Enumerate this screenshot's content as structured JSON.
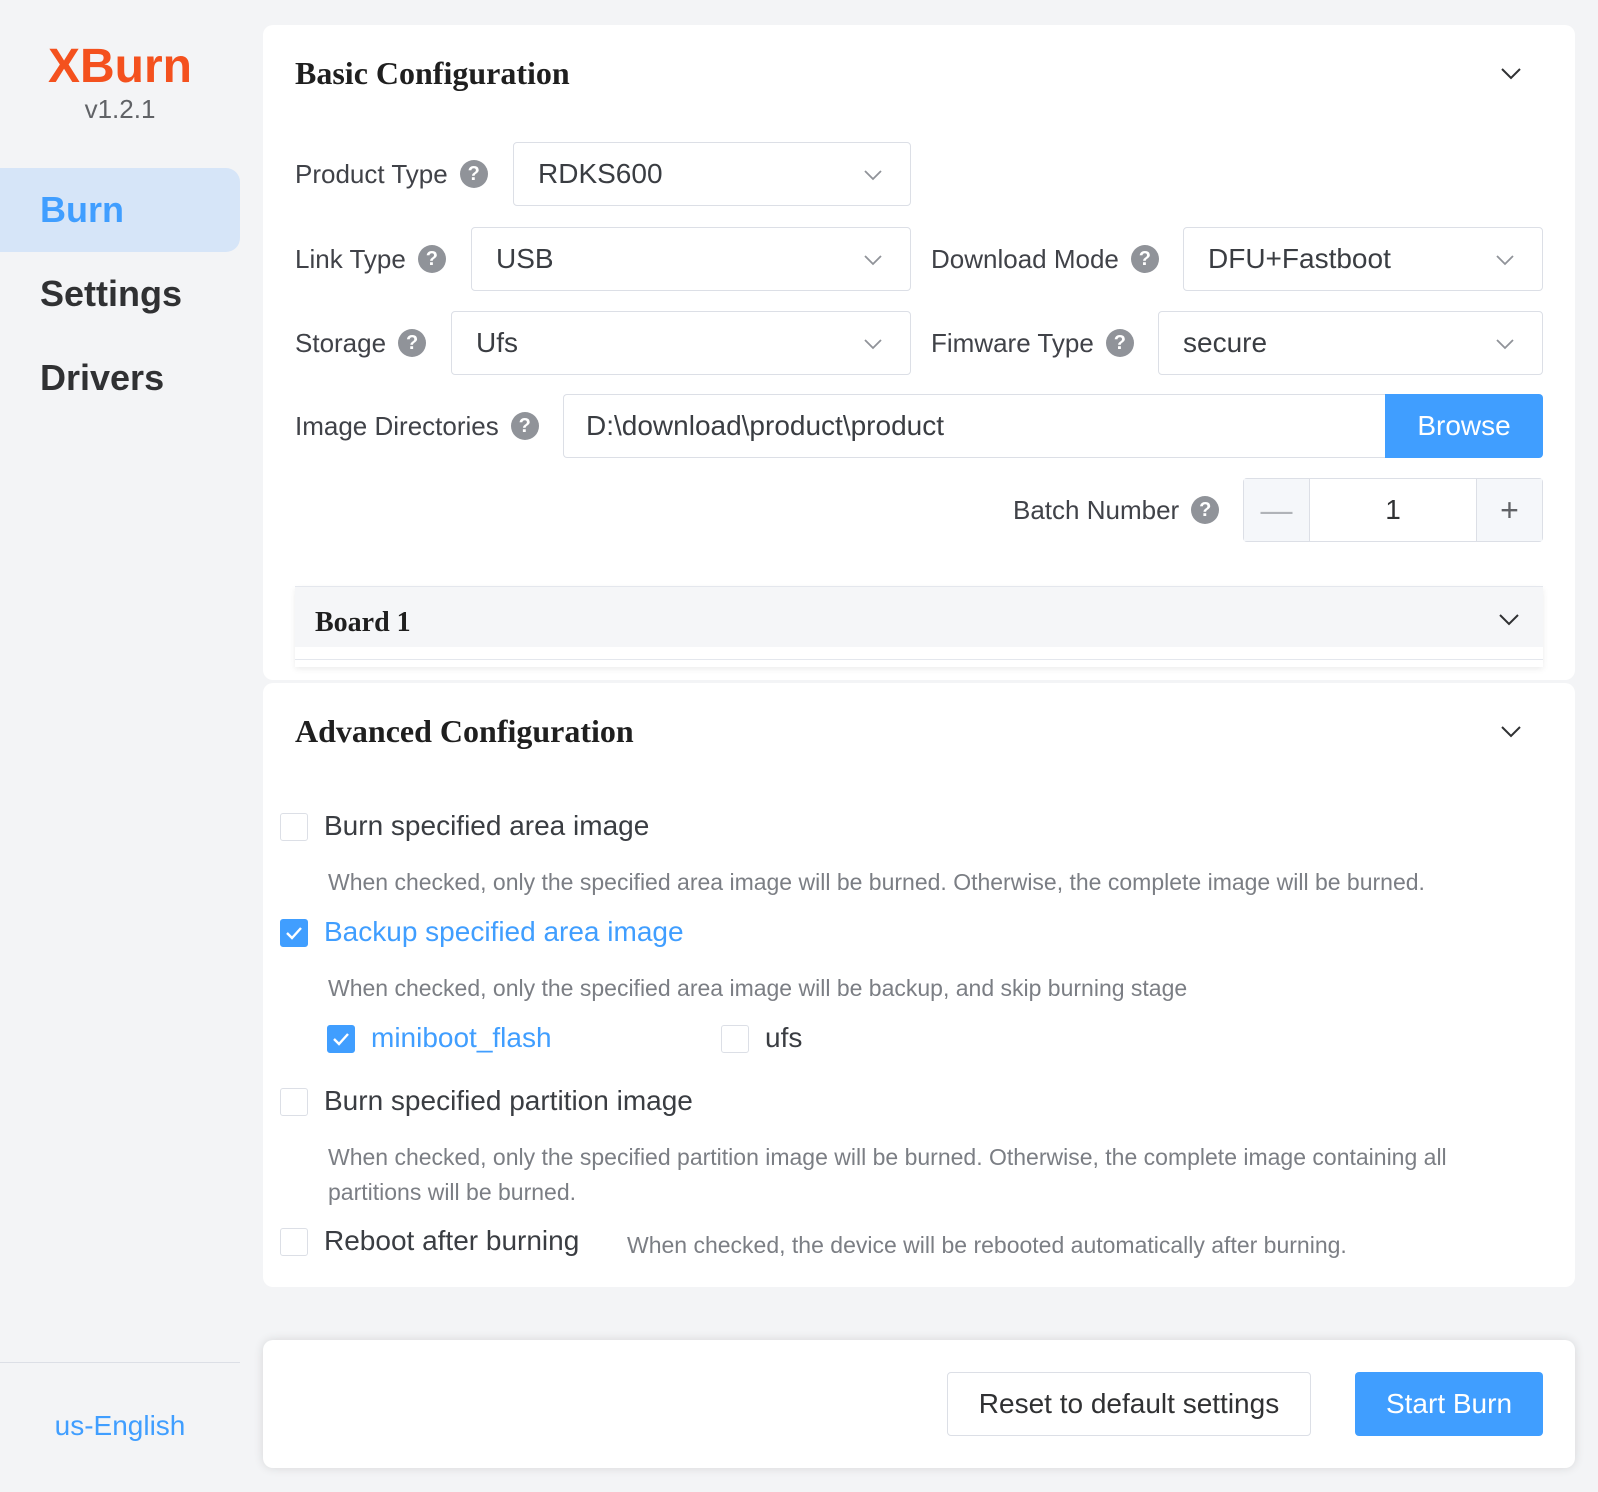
{
  "app": {
    "name": "XBurn",
    "version": "v1.2.1"
  },
  "nav": [
    {
      "label": "Burn",
      "active": true
    },
    {
      "label": "Settings",
      "active": false
    },
    {
      "label": "Drivers",
      "active": false
    }
  ],
  "language": "us-English",
  "basic": {
    "title": "Basic Configuration",
    "product_type": {
      "label": "Product Type",
      "value": "RDKS600"
    },
    "link_type": {
      "label": "Link Type",
      "value": "USB"
    },
    "download_mode": {
      "label": "Download Mode",
      "value": "DFU+Fastboot"
    },
    "storage": {
      "label": "Storage",
      "value": "Ufs"
    },
    "firmware_type": {
      "label": "Fimware Type",
      "value": "secure"
    },
    "image_dir": {
      "label": "Image Directories",
      "value": "D:\\download\\product\\product",
      "browse_label": "Browse"
    },
    "batch": {
      "label": "Batch Number",
      "value": "1",
      "minus": "—",
      "plus": "+"
    },
    "board_title": "Board 1",
    "help_glyph": "?"
  },
  "advanced": {
    "title": "Advanced Configuration",
    "burn_area": {
      "label": "Burn specified area image",
      "checked": false,
      "hint": "When checked, only the specified area image will be burned. Otherwise, the complete image will be burned."
    },
    "backup_area": {
      "label": "Backup specified area image",
      "checked": true,
      "hint": "When checked, only the specified area image will be backup, and skip burning stage"
    },
    "backup_options": [
      {
        "label": "miniboot_flash",
        "checked": true
      },
      {
        "label": "ufs",
        "checked": false
      }
    ],
    "burn_partition": {
      "label": "Burn specified partition image",
      "checked": false,
      "hint_line1": "When checked, only the specified partition image will be burned. Otherwise, the complete image containing all",
      "hint_line2": "partitions will be burned."
    },
    "reboot": {
      "label": "Reboot after burning",
      "checked": false,
      "hint": "When checked, the device will be rebooted automatically after burning."
    }
  },
  "footer": {
    "reset_label": "Reset to default settings",
    "start_label": "Start Burn"
  },
  "colors": {
    "accent": "#409eff",
    "brand": "#f4511e",
    "nav_active_bg": "#d6e5f8"
  },
  "icons": {
    "collapse": "chevron-down-icon",
    "help": "question-circle-icon",
    "check": "check-icon"
  }
}
